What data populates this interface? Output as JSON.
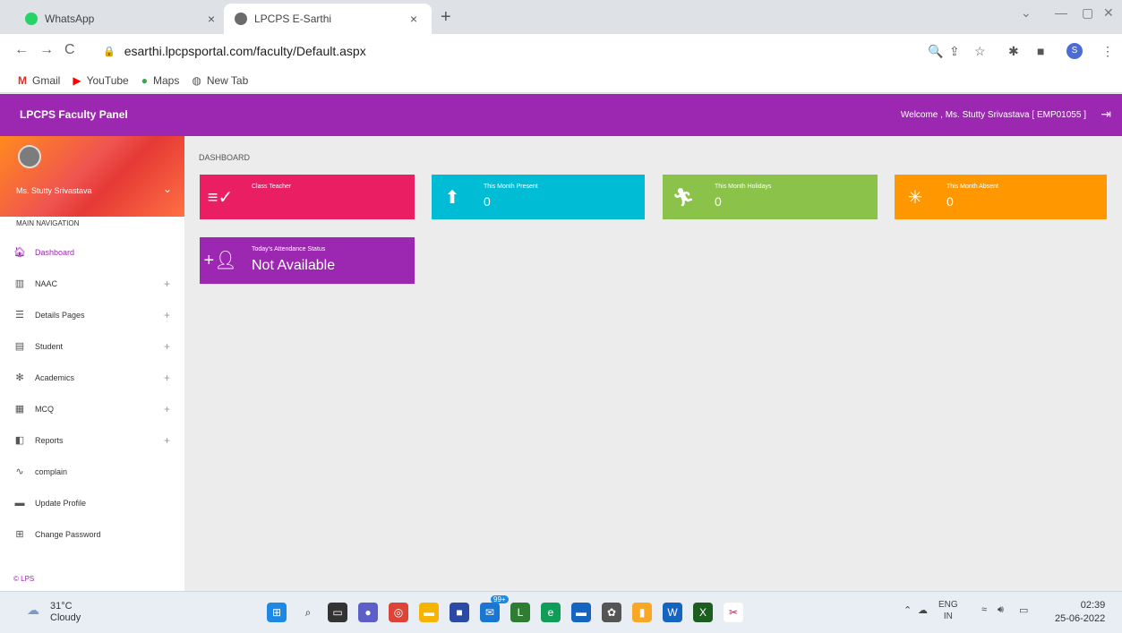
{
  "browser": {
    "tabs": [
      {
        "title": "WhatsApp",
        "close": "×"
      },
      {
        "title": "LPCPS E-Sarthi",
        "close": "×"
      }
    ],
    "new_tab": "+",
    "nav": {
      "back": "←",
      "forward": "→",
      "reload": "C"
    },
    "url": "esarthi.lpcpsportal.com/faculty/Default.aspx",
    "profile_initial": "S",
    "bookmarks": [
      "Gmail",
      "YouTube",
      "Maps",
      "New Tab"
    ]
  },
  "app": {
    "title": "LPCPS Faculty Panel",
    "welcome": "Welcome , Ms. Stutty Srivastava [ EMP01055 ]",
    "user_name": "Ms. Stutty Srivastava"
  },
  "sidebar": {
    "header": "MAIN NAVIGATION",
    "items": [
      {
        "label": "Dashboard",
        "icon": "home-icon",
        "expand": ""
      },
      {
        "label": "NAAC",
        "icon": "grid-icon",
        "expand": "+"
      },
      {
        "label": "Details Pages",
        "icon": "list-icon",
        "expand": "+"
      },
      {
        "label": "Student",
        "icon": "clipboard-icon",
        "expand": "+"
      },
      {
        "label": "Academics",
        "icon": "academics-icon",
        "expand": "+"
      },
      {
        "label": "MCQ",
        "icon": "chart-icon",
        "expand": "+"
      },
      {
        "label": "Reports",
        "icon": "reports-icon",
        "expand": "+"
      },
      {
        "label": "complain",
        "icon": "trend-icon",
        "expand": ""
      },
      {
        "label": "Update Profile",
        "icon": "profile-icon",
        "expand": ""
      },
      {
        "label": "Change Password",
        "icon": "password-icon",
        "expand": ""
      }
    ],
    "footer": "© LPS"
  },
  "content": {
    "breadcrumb": "DASHBOARD",
    "boxes": [
      {
        "label": "Class Teacher",
        "value": "",
        "color": "#e91e63"
      },
      {
        "label": "This Month Present",
        "value": "0",
        "color": "#00bcd4"
      },
      {
        "label": "This Month Holidays",
        "value": "0",
        "color": "#8bc34a"
      },
      {
        "label": "This Month Absent",
        "value": "0",
        "color": "#ff9800"
      },
      {
        "label": "Today's Attendance Status",
        "value": "Not Available",
        "color": "#9c27b0"
      }
    ]
  },
  "taskbar": {
    "temperature": "31°C",
    "weather": "Cloudy",
    "lang_top": "ENG",
    "lang_bottom": "IN",
    "time": "02:39",
    "date": "25-06-2022",
    "badge": "99+"
  },
  "colors": {
    "header": "#9c27b0",
    "accent": "#9c27b0"
  }
}
